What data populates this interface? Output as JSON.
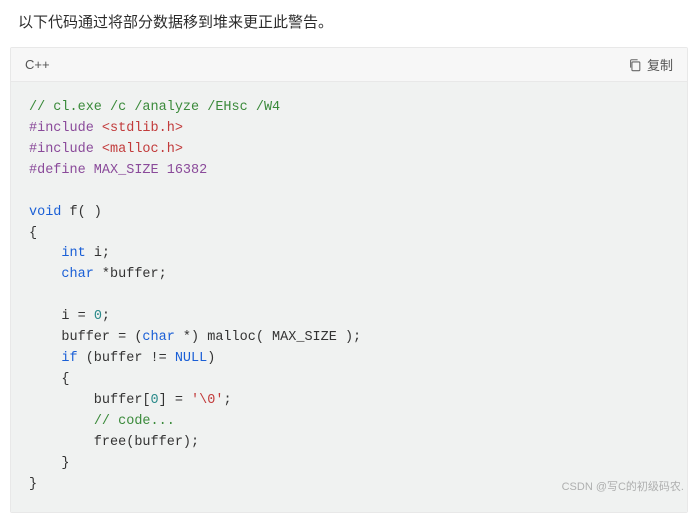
{
  "intro": "以下代码通过将部分数据移到堆来更正此警告。",
  "code": {
    "language": "C++",
    "copy_label": "复制",
    "tokens": [
      [
        [
          "// cl.exe /c /analyze /EHsc /W4",
          "comment"
        ]
      ],
      [
        [
          "#include ",
          "preproc"
        ],
        [
          "<stdlib.h>",
          "header"
        ]
      ],
      [
        [
          "#include ",
          "preproc"
        ],
        [
          "<malloc.h>",
          "header"
        ]
      ],
      [
        [
          "#define MAX_SIZE 16382",
          "preproc"
        ]
      ],
      [
        [
          "",
          ""
        ]
      ],
      [
        [
          "void",
          "keyword"
        ],
        [
          " f( )",
          ""
        ]
      ],
      [
        [
          "{",
          ""
        ]
      ],
      [
        [
          "    ",
          ""
        ],
        [
          "int",
          "keyword"
        ],
        [
          " i;",
          ""
        ]
      ],
      [
        [
          "    ",
          ""
        ],
        [
          "char",
          "keyword"
        ],
        [
          " *buffer;",
          ""
        ]
      ],
      [
        [
          "",
          ""
        ]
      ],
      [
        [
          "    i = ",
          ""
        ],
        [
          "0",
          "number"
        ],
        [
          ";",
          ""
        ]
      ],
      [
        [
          "    buffer = (",
          ""
        ],
        [
          "char",
          "keyword"
        ],
        [
          " *) malloc( MAX_SIZE );",
          ""
        ]
      ],
      [
        [
          "    ",
          ""
        ],
        [
          "if",
          "keyword"
        ],
        [
          " (buffer != ",
          ""
        ],
        [
          "NULL",
          "keyword"
        ],
        [
          ")",
          ""
        ]
      ],
      [
        [
          "    {",
          ""
        ]
      ],
      [
        [
          "        buffer[",
          ""
        ],
        [
          "0",
          "number"
        ],
        [
          "] = ",
          ""
        ],
        [
          "'\\0'",
          "string"
        ],
        [
          ";",
          ""
        ]
      ],
      [
        [
          "        ",
          ""
        ],
        [
          "// code...",
          "comment"
        ]
      ],
      [
        [
          "        free(buffer);",
          ""
        ]
      ],
      [
        [
          "    }",
          ""
        ]
      ],
      [
        [
          "}",
          ""
        ]
      ]
    ]
  },
  "watermark": "CSDN @写C的初级码农."
}
